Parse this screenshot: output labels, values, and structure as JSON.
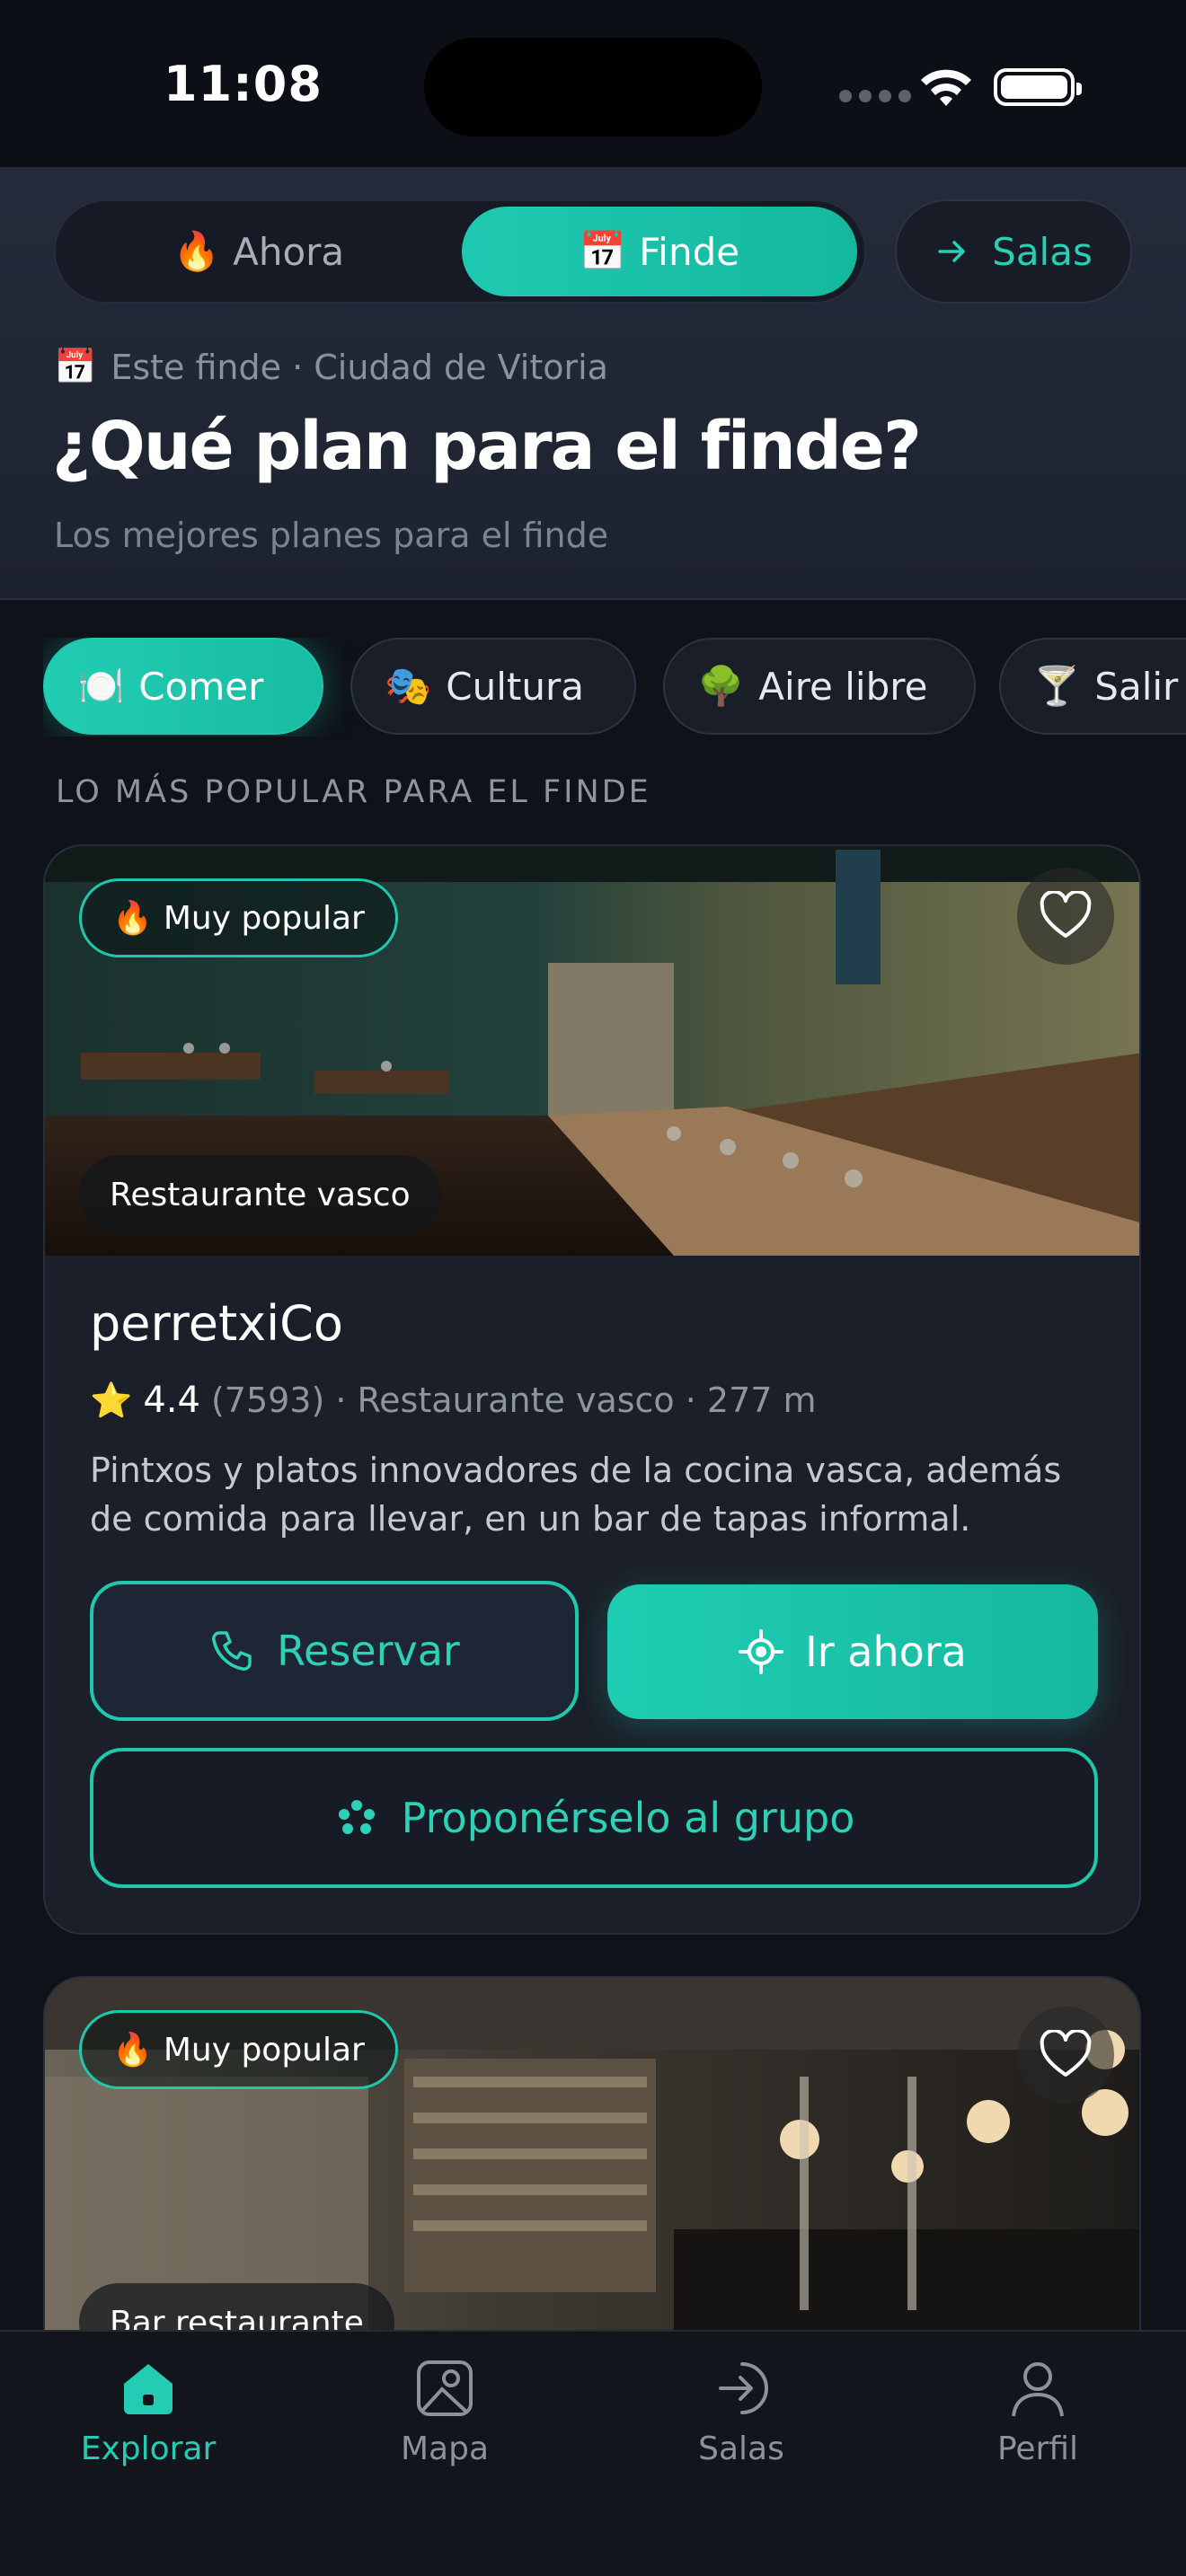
{
  "status": {
    "time": "11:08"
  },
  "header": {
    "segments": [
      {
        "icon": "🔥",
        "label": "Ahora",
        "active": false
      },
      {
        "icon": "📅",
        "label": "Finde",
        "active": true
      }
    ],
    "salas_label": "Salas",
    "meta_icon": "📅",
    "meta": "Este finde · Ciudad de Vitoria",
    "title": "¿Qué plan para el finde?",
    "subtitle": "Los mejores planes para el finde"
  },
  "categories": [
    {
      "icon": "🍽️",
      "label": "Comer",
      "active": true
    },
    {
      "icon": "🎭",
      "label": "Cultura",
      "active": false
    },
    {
      "icon": "🌳",
      "label": "Aire libre",
      "active": false
    },
    {
      "icon": "🍸",
      "label": "Salir",
      "active": false
    }
  ],
  "section_label": "LO MÁS POPULAR PARA EL FINDE",
  "cards": [
    {
      "badge_icon": "🔥",
      "badge": "Muy popular",
      "type_pill": "Restaurante vasco",
      "name": "perretxiCo",
      "star": "⭐",
      "rating": "4.4",
      "reviews": "(7593)",
      "details": "· Restaurante vasco · 277 m",
      "description": "Pintxos y platos innovadores de la cocina vasca, además de comida para llevar, en un bar de tapas informal.",
      "reserve_label": "Reservar",
      "go_label": "Ir ahora",
      "group_label": "Proponérselo al grupo"
    },
    {
      "badge_icon": "🔥",
      "badge": "Muy popular",
      "type_pill": "Bar restaurante"
    }
  ],
  "tabbar": [
    {
      "label": "Explorar",
      "icon": "home-icon",
      "active": true
    },
    {
      "label": "Mapa",
      "icon": "map-icon",
      "active": false
    },
    {
      "label": "Salas",
      "icon": "enter-icon",
      "active": false
    },
    {
      "label": "Perfil",
      "icon": "person-icon",
      "active": false
    }
  ],
  "colors": {
    "accent": "#1fc7ac",
    "background": "#0f1219",
    "card": "#1b1f29"
  }
}
